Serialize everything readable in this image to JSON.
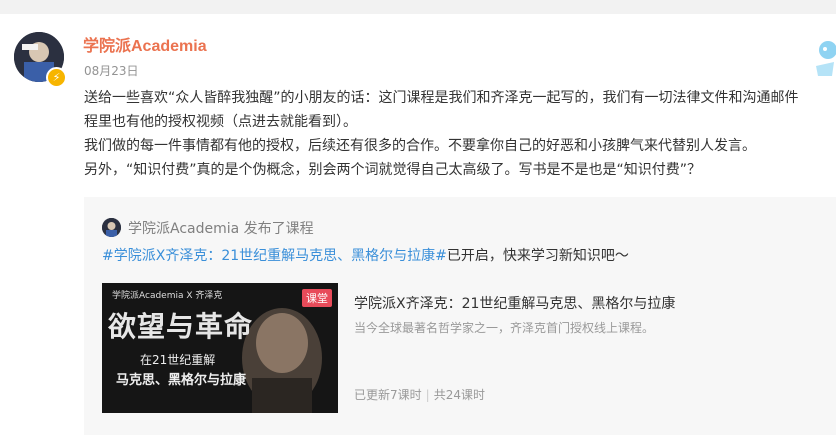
{
  "post": {
    "username": "学院派Academia",
    "timestamp": "08月23日",
    "lines": [
      "送给一些喜欢“众人皆醉我独醒”的小朋友的话：这门课程是我们和齐泽克一起写的，我们有一切法律文件和沟通邮件",
      "程里也有他的授权视频（点进去就能看到）。",
      "我们做的每一件事情都有他的授权，后续还有很多的合作。不要拿你自己的好恶和小孩脾气来代替别人发言。",
      "另外，“知识付费”真的是个伪概念，别会两个词就觉得自己太高级了。写书是不是也是“知识付费”？"
    ]
  },
  "repost": {
    "author": "学院派Academia",
    "action": "发布了课程",
    "hashtag": "#学院派X齐泽克：21世纪重解马克思、黑格尔与拉康#",
    "text_after": "已开启，快来学习新知识吧～"
  },
  "course": {
    "title": "学院派X齐泽克：21世纪重解马克思、黑格尔与拉康",
    "description": "当今全球最著名哲学家之一，齐泽克首门授权线上课程。",
    "updated": "已更新7课时",
    "total": "共24课时",
    "thumbnail": {
      "top_label": "学院派Academia X 齐泽克",
      "badge": "课堂",
      "title": "欲望与革命",
      "subtitle_1": "在21世纪重解",
      "subtitle_2": "马克思、黑格尔与拉康"
    }
  },
  "colors": {
    "username": "#eb7350",
    "hashtag": "#3a8fd9",
    "badge": "#e84b5a"
  }
}
